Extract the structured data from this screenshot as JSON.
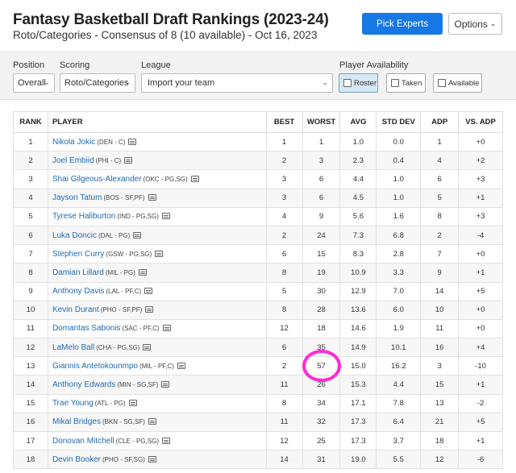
{
  "header": {
    "title": "Fantasy Basketball Draft Rankings (2023-24)",
    "subtitle": "Roto/Categories - Consensus of 8 (10 available) - Oct 16, 2023",
    "pick_experts_label": "Pick Experts",
    "options_label": "Options"
  },
  "filters": {
    "position": {
      "label": "Position",
      "value": "Overall"
    },
    "scoring": {
      "label": "Scoring",
      "value": "Roto/Categories"
    },
    "league": {
      "label": "League",
      "value": "Import your team"
    },
    "availability": {
      "label": "Player Availability",
      "options": [
        {
          "label": "Roster",
          "active": true
        },
        {
          "label": "Taken",
          "active": false
        },
        {
          "label": "Available",
          "active": false
        }
      ]
    }
  },
  "table": {
    "columns": [
      "RANK",
      "PLAYER",
      "BEST",
      "WORST",
      "AVG",
      "STD DEV",
      "ADP",
      "VS. ADP"
    ],
    "rows": [
      {
        "rank": "1",
        "name": "Nikola Jokic",
        "info": "(DEN - C)",
        "best": "1",
        "worst": "1",
        "avg": "1.0",
        "std": "0.0",
        "adp": "1",
        "vs": "+0"
      },
      {
        "rank": "2",
        "name": "Joel Embiid",
        "info": "(PHI - C)",
        "best": "2",
        "worst": "3",
        "avg": "2.3",
        "std": "0.4",
        "adp": "4",
        "vs": "+2"
      },
      {
        "rank": "3",
        "name": "Shai Gilgeous-Alexander",
        "info": "(OKC - PG,SG)",
        "best": "3",
        "worst": "6",
        "avg": "4.4",
        "std": "1.0",
        "adp": "6",
        "vs": "+3"
      },
      {
        "rank": "4",
        "name": "Jayson Tatum",
        "info": "(BOS - SF,PF)",
        "best": "3",
        "worst": "6",
        "avg": "4.5",
        "std": "1.0",
        "adp": "5",
        "vs": "+1"
      },
      {
        "rank": "5",
        "name": "Tyrese Haliburton",
        "info": "(IND - PG,SG)",
        "best": "4",
        "worst": "9",
        "avg": "5.6",
        "std": "1.6",
        "adp": "8",
        "vs": "+3"
      },
      {
        "rank": "6",
        "name": "Luka Doncic",
        "info": "(DAL - PG)",
        "best": "2",
        "worst": "24",
        "avg": "7.3",
        "std": "6.8",
        "adp": "2",
        "vs": "-4"
      },
      {
        "rank": "7",
        "name": "Stephen Curry",
        "info": "(GSW - PG,SG)",
        "best": "6",
        "worst": "15",
        "avg": "8.3",
        "std": "2.8",
        "adp": "7",
        "vs": "+0"
      },
      {
        "rank": "8",
        "name": "Damian Lillard",
        "info": "(MIL - PG)",
        "best": "8",
        "worst": "19",
        "avg": "10.9",
        "std": "3.3",
        "adp": "9",
        "vs": "+1"
      },
      {
        "rank": "9",
        "name": "Anthony Davis",
        "info": "(LAL - PF,C)",
        "best": "5",
        "worst": "30",
        "avg": "12.9",
        "std": "7.0",
        "adp": "14",
        "vs": "+5"
      },
      {
        "rank": "10",
        "name": "Kevin Durant",
        "info": "(PHO - SF,PF)",
        "best": "8",
        "worst": "28",
        "avg": "13.6",
        "std": "6.0",
        "adp": "10",
        "vs": "+0"
      },
      {
        "rank": "11",
        "name": "Domantas Sabonis",
        "info": "(SAC - PF,C)",
        "best": "12",
        "worst": "18",
        "avg": "14.6",
        "std": "1.9",
        "adp": "11",
        "vs": "+0"
      },
      {
        "rank": "12",
        "name": "LaMelo Ball",
        "info": "(CHA - PG,SG)",
        "best": "6",
        "worst": "35",
        "avg": "14.9",
        "std": "10.1",
        "adp": "16",
        "vs": "+4"
      },
      {
        "rank": "13",
        "name": "Giannis Antetokounmpo",
        "info": "(MIL - PF,C)",
        "best": "2",
        "worst": "57",
        "avg": "15.0",
        "std": "16.2",
        "adp": "3",
        "vs": "-10"
      },
      {
        "rank": "14",
        "name": "Anthony Edwards",
        "info": "(MIN - SG,SF)",
        "best": "11",
        "worst": "26",
        "avg": "15.3",
        "std": "4.4",
        "adp": "15",
        "vs": "+1"
      },
      {
        "rank": "15",
        "name": "Trae Young",
        "info": "(ATL - PG)",
        "best": "8",
        "worst": "34",
        "avg": "17.1",
        "std": "7.8",
        "adp": "13",
        "vs": "-2"
      },
      {
        "rank": "16",
        "name": "Mikal Bridges",
        "info": "(BKN - SG,SF)",
        "best": "11",
        "worst": "32",
        "avg": "17.3",
        "std": "6.4",
        "adp": "21",
        "vs": "+5"
      },
      {
        "rank": "17",
        "name": "Donovan Mitchell",
        "info": "(CLE - PG,SG)",
        "best": "12",
        "worst": "25",
        "avg": "17.3",
        "std": "3.7",
        "adp": "18",
        "vs": "+1"
      },
      {
        "rank": "18",
        "name": "Devin Booker",
        "info": "(PHO - SF,SG)",
        "best": "14",
        "worst": "31",
        "avg": "19.0",
        "std": "5.5",
        "adp": "12",
        "vs": "-6"
      }
    ]
  },
  "highlight": {
    "color": "#ff2bd6"
  }
}
